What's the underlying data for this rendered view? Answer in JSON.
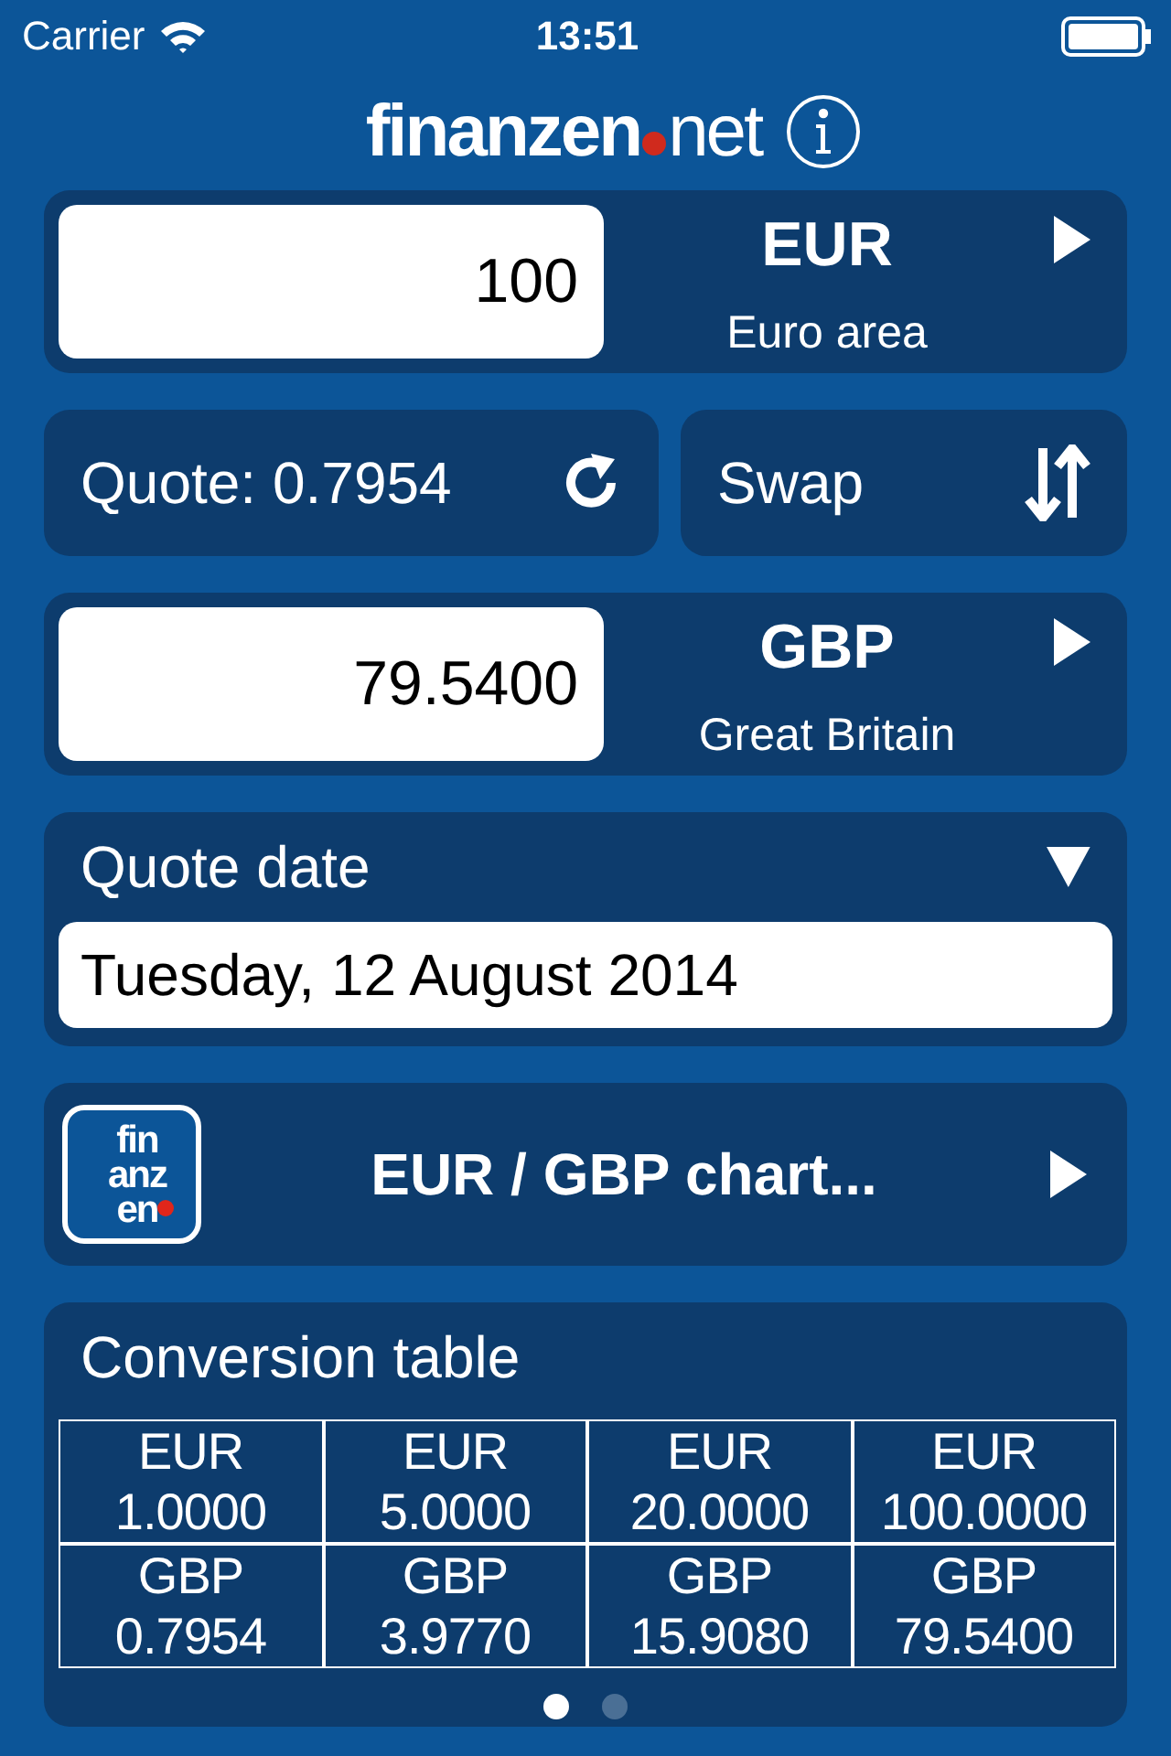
{
  "status_bar": {
    "carrier": "Carrier",
    "time": "13:51"
  },
  "logo": {
    "brand": "finanzen",
    "suffix": "net"
  },
  "from": {
    "amount": "100",
    "code": "EUR",
    "name": "Euro area"
  },
  "quote": {
    "label": "Quote: 0.7954"
  },
  "swap": {
    "label": "Swap"
  },
  "to": {
    "amount": "79.5400",
    "code": "GBP",
    "name": "Great Britain"
  },
  "quote_date": {
    "label": "Quote date",
    "value": "Tuesday, 12 August 2014"
  },
  "chart_link": {
    "icon_lines": [
      "fin",
      "anz",
      "en"
    ],
    "label": "EUR / GBP chart..."
  },
  "conversion_table": {
    "title": "Conversion table",
    "rows": [
      [
        {
          "code": "EUR",
          "amount": "1.0000"
        },
        {
          "code": "EUR",
          "amount": "5.0000"
        },
        {
          "code": "EUR",
          "amount": "20.0000"
        },
        {
          "code": "EUR",
          "amount": "100.0000"
        }
      ],
      [
        {
          "code": "GBP",
          "amount": "0.7954"
        },
        {
          "code": "GBP",
          "amount": "3.9770"
        },
        {
          "code": "GBP",
          "amount": "15.9080"
        },
        {
          "code": "GBP",
          "amount": "79.5400"
        }
      ]
    ],
    "pages": [
      {
        "selected": true
      },
      {
        "selected": false
      }
    ]
  }
}
